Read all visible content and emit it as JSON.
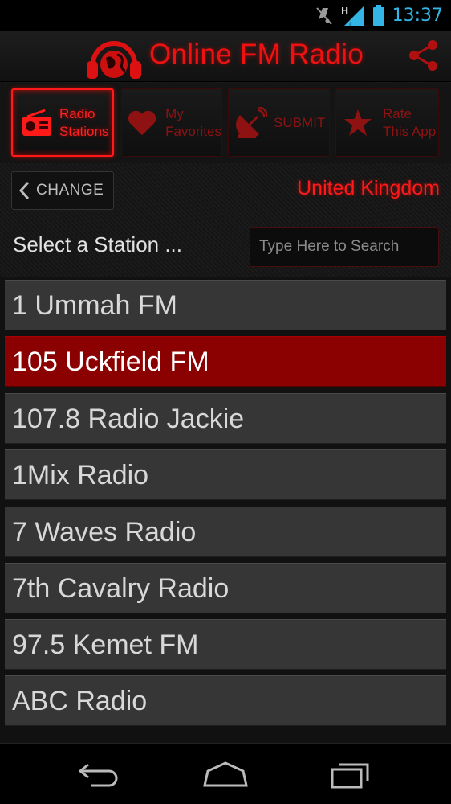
{
  "status_bar": {
    "time": "13:37",
    "icons": [
      "mute-icon",
      "signal-h-icon",
      "battery-icon"
    ],
    "accent": "#33b5e5"
  },
  "header": {
    "title": "Online FM Radio",
    "logo": "headphone-globe-logo",
    "share_icon": "share-icon",
    "accent": "#ee1111"
  },
  "tabs": [
    {
      "id": "radio-stations",
      "label": "Radio\nStations",
      "icon": "radio-icon",
      "active": true
    },
    {
      "id": "my-favorites",
      "label": "My\nFavorites",
      "icon": "heart-icon",
      "active": false
    },
    {
      "id": "submit",
      "label": "SUBMIT",
      "icon": "satellite-dish-icon",
      "active": false
    },
    {
      "id": "rate-app",
      "label": "Rate\nThis App",
      "icon": "star-icon",
      "active": false
    }
  ],
  "change_button": {
    "label": "CHANGE",
    "icon": "chevron-left-icon"
  },
  "country": "United Kingdom",
  "search": {
    "label": "Select a Station ...",
    "placeholder": "Type Here to Search",
    "value": ""
  },
  "stations": [
    {
      "name": "1 Ummah FM",
      "selected": false
    },
    {
      "name": "105 Uckfield FM",
      "selected": true
    },
    {
      "name": "107.8 Radio Jackie",
      "selected": false
    },
    {
      "name": "1Mix Radio",
      "selected": false
    },
    {
      "name": "7 Waves Radio",
      "selected": false
    },
    {
      "name": "7th Cavalry Radio",
      "selected": false
    },
    {
      "name": "97.5 Kemet FM",
      "selected": false
    },
    {
      "name": "ABC Radio",
      "selected": false
    }
  ],
  "nav_bar": {
    "buttons": [
      "back-icon",
      "home-icon",
      "recent-apps-icon"
    ]
  },
  "colors": {
    "selected_row": "#8b0000",
    "row": "#363636",
    "brand_red": "#ff1a1a"
  }
}
